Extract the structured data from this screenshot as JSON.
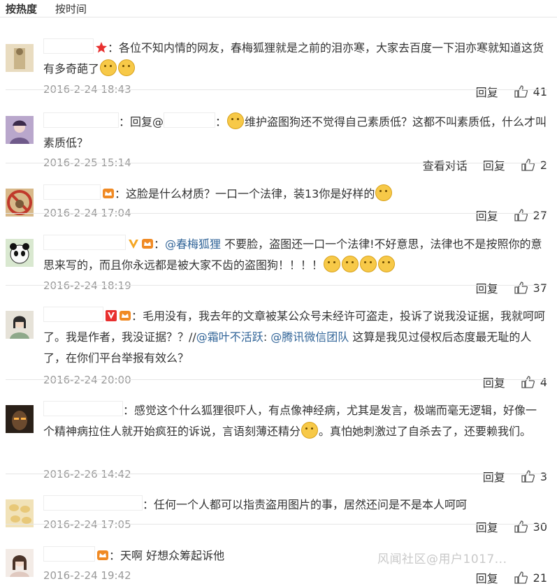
{
  "tabs": {
    "hot": "按热度",
    "time": "按时间"
  },
  "actions": {
    "reply": "回复",
    "view_dialog": "查看对话"
  },
  "watermark": "风闻社区@用户1017...",
  "comments": [
    {
      "text": "：各位不知内情的网友，春梅狐狸就是之前的泪亦寒，大家去百度一下泪亦寒就知道这货有多奇葩了",
      "time": "2016-2-24 18:43",
      "likes": "41"
    },
    {
      "text_a": "：回复@",
      "text_b": "：",
      "text_c": "维护盗图狗还不觉得自己素质低？这都不叫素质低，什么才叫素质低？",
      "time": "2016-2-25 15:14",
      "likes": "2"
    },
    {
      "text": "：这脸是什么材质？一口一个法律，装13你是好样的",
      "time": "2016-2-24 17:04",
      "likes": "27"
    },
    {
      "prefix": "：",
      "mention": "@春梅狐狸",
      "text": " 不要脸，盗图还一口一个法律!不好意思，法律也不是按照你的意思来写的，而且你永远都是被大家不齿的盗图狗！！！！",
      "time": "2016-2-24 18:19",
      "likes": "37"
    },
    {
      "text_a": "：毛用没有，我去年的文章被某公众号未经许可盗走，投诉了说我没证据，我就呵呵了。我是作者，我没证据？？//",
      "mention1": "@霜叶不活跃",
      "colon": ": ",
      "mention2": "@腾讯微信团队",
      "text_b": " 这算是我见过侵权后态度最无耻的人了，在你们平台举报有效么？",
      "time": "2016-2-24 20:00",
      "likes": "4"
    },
    {
      "text_a": "：感觉这个什么狐狸很吓人，有点像神经病，尤其是发言，极端而毫无逻辑，好像一个精神病拉住人就开始疯狂的诉说，言语刻薄还精分",
      "text_b": "。真怕她刺激过了自杀去了，还要赖我们。",
      "time": "2016-2-26 14:42",
      "likes": "3"
    },
    {
      "text": "：任何一个人都可以指责盗用图片的事，居然还问是不是本人呵呵",
      "time": "2016-2-24 17:05",
      "likes": "30"
    },
    {
      "text": "：天啊 好想众筹起诉他",
      "time": "2016-2-24 19:42",
      "likes": "21"
    }
  ]
}
